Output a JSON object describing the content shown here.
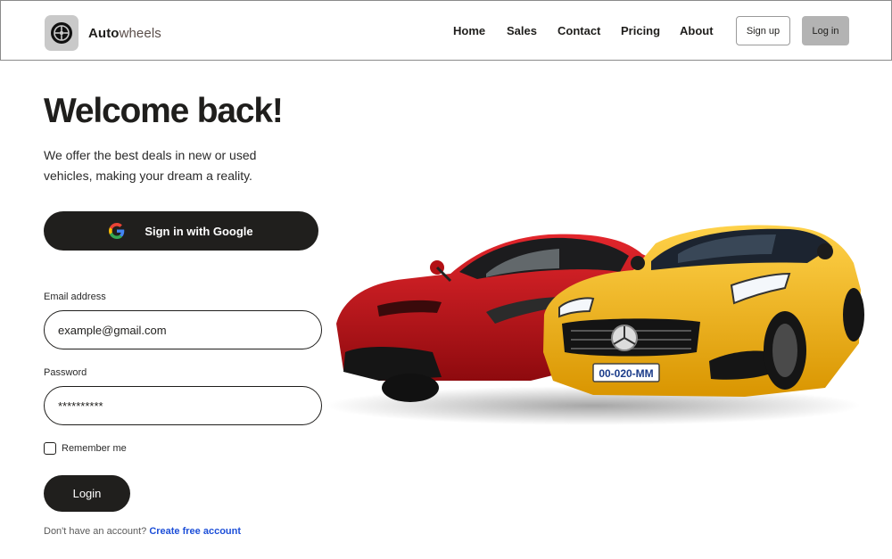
{
  "navbar": {
    "brand": {
      "bold": "Auto",
      "light": "wheels",
      "icon": "tire-wheel-icon"
    },
    "links": [
      "Home",
      "Sales",
      "Contact",
      "Pricing",
      "About"
    ],
    "signup_label": "Sign up",
    "login_label": "Log in"
  },
  "hero": {
    "title": "Welcome back!",
    "subtitle": "We offer the best deals in new or used vehicles, making your dream a reality."
  },
  "google_button": {
    "label": "Sign in with Google",
    "icon": "google-g-icon"
  },
  "form": {
    "email": {
      "label": "Email address",
      "value": "example@gmail.com"
    },
    "password": {
      "label": "Password",
      "value": "**********"
    },
    "remember_label": "Remember me",
    "remember_checked": false,
    "submit_label": "Login"
  },
  "footer_prompt": {
    "text": "Don't have an account?",
    "link": "Create free account"
  },
  "hero_image": {
    "plate_text": "00-020-MM"
  },
  "colors": {
    "dark": "#201f1d",
    "link_blue": "#1d4fd8",
    "login_nav_bg": "#b3b3b3",
    "car_red": "#c8141a",
    "car_yellow": "#f5b400"
  }
}
